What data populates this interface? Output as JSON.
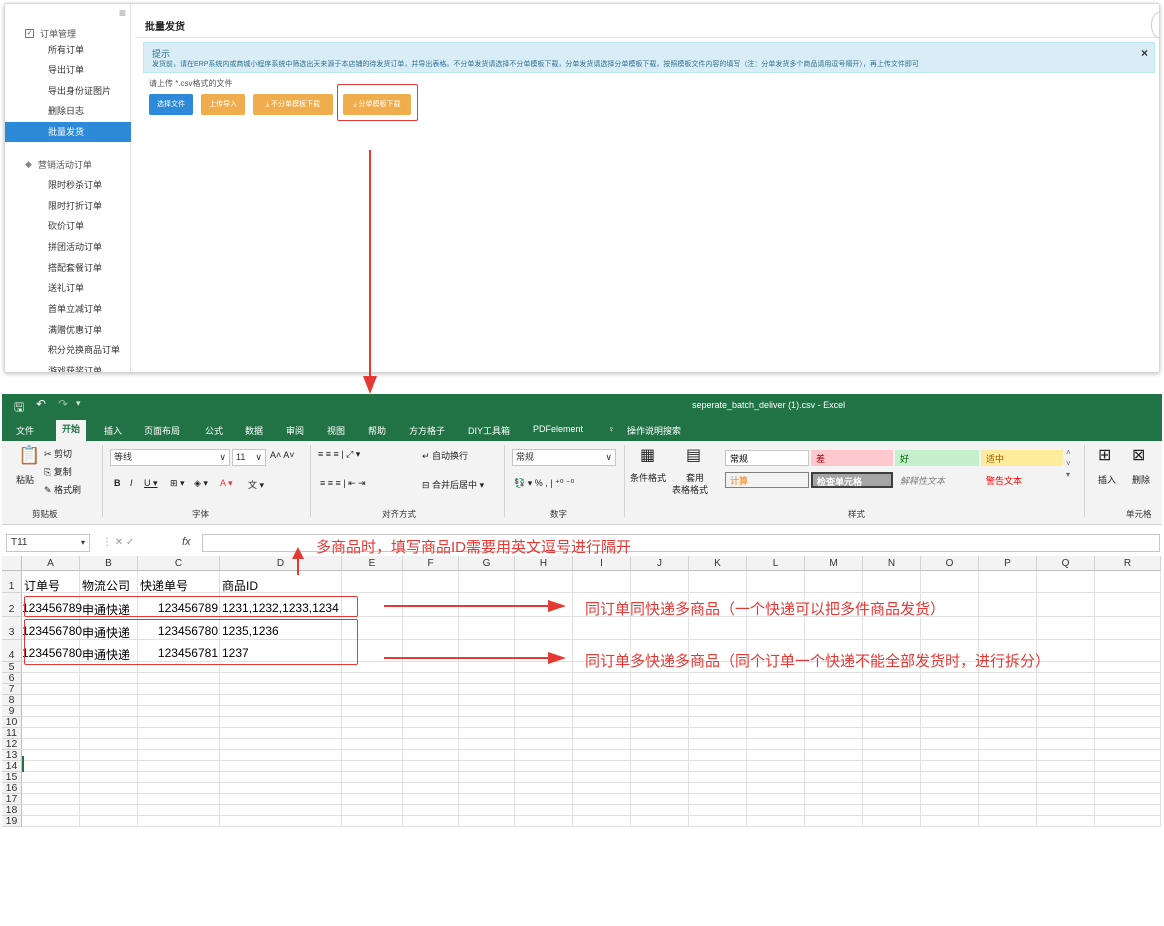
{
  "web": {
    "sidebar": {
      "order_group": "订单管理",
      "order_items": [
        "所有订单",
        "导出订单",
        "导出身份证图片",
        "删除日志",
        "批量发货"
      ],
      "marketing_group": "营销活动订单",
      "marketing_items": [
        "限时秒杀订单",
        "限时打折订单",
        "砍价订单",
        "拼团活动订单",
        "搭配套餐订单",
        "送礼订单",
        "首单立减订单",
        "满赠优惠订单",
        "积分兑换商品订单",
        "游戏获奖订单"
      ]
    },
    "page_title": "批量发货",
    "tip_title": "提示",
    "tip_body": "发货前，请在ERP系统内或商城小程序系统中筛选出天来源于本店铺的待发货订单，并导出表格。不分单发货请选择不分单模板下载，分单发货请选择分单模板下载，按照模板文件内容的填写（注：分单发货多个商品请用逗号隔开），再上传文件即可",
    "tip_close": "×",
    "upload_hint": "请上传 *.csv格式的文件",
    "buttons": {
      "choose_file": "选择文件",
      "upload_import": "上传导入",
      "no_split_download": "不分单模板下载",
      "split_download": "分单模板下载"
    }
  },
  "excel": {
    "title": "seperate_batch_deliver (1).csv  -  Excel",
    "menu": [
      "文件",
      "开始",
      "插入",
      "页面布局",
      "公式",
      "数据",
      "审阅",
      "视图",
      "帮助",
      "方方格子",
      "DIY工具箱",
      "PDFelement",
      "操作说明搜索"
    ],
    "ribbon": {
      "paste": "粘贴",
      "cut": "剪切",
      "copy": "复制",
      "format_painter": "格式刷",
      "clipboard": "剪贴板",
      "font_name": "等线",
      "font_size": "11",
      "font_group": "字体",
      "wrap": "自动换行",
      "merge": "合并后居中",
      "align_group": "对齐方式",
      "number_format": "常规",
      "number_group": "数字",
      "cond_format": "条件格式",
      "table_format_1": "套用",
      "table_format_2": "表格格式",
      "styles": {
        "normal": "常规",
        "bad": "差",
        "good": "好",
        "neutral": "适中",
        "calc": "计算",
        "check": "检查单元格",
        "explain": "解释性文本",
        "warn": "警告文本"
      },
      "styles_group": "样式",
      "insert": "插入",
      "delete": "删除",
      "cells_group": "单元格"
    },
    "name_box": "T11",
    "fx": "fx",
    "columns": [
      "A",
      "B",
      "C",
      "D",
      "E",
      "F",
      "G",
      "H",
      "I",
      "J",
      "K",
      "L",
      "M",
      "N",
      "O",
      "P",
      "Q",
      "R"
    ],
    "rows": [
      "1",
      "2",
      "3",
      "4",
      "5",
      "6",
      "7",
      "8",
      "9",
      "10",
      "11",
      "12",
      "13",
      "14",
      "15",
      "16",
      "17",
      "18",
      "19"
    ],
    "header": [
      "订单号",
      "物流公司",
      "快递单号",
      "商品ID"
    ],
    "data": [
      [
        "123456789",
        "申通快递",
        "123456789",
        "1231,1232,1233,1234"
      ],
      [
        "123456780",
        "申通快递",
        "123456780",
        "1235,1236"
      ],
      [
        "123456780",
        "申通快递",
        "123456781",
        "1237"
      ]
    ]
  },
  "annotations": {
    "note_top": "多商品时，填写商品ID需要用英文逗号进行隔开",
    "note_row2": "同订单同快递多商品（一个快递可以把多件商品发货）",
    "note_row34": "同订单多快递多商品（同个订单一个快递不能全部发货时，进行拆分）"
  }
}
